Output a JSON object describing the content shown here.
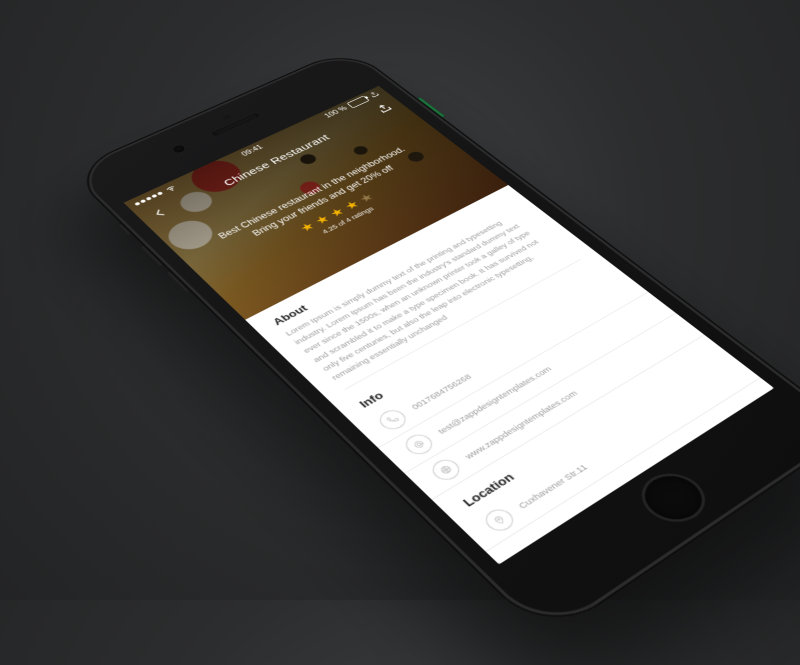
{
  "status_bar": {
    "time": "09:41",
    "carrier_signal_dots": 5,
    "wifi_icon": "wifi-icon",
    "battery_pct": "100 %"
  },
  "nav": {
    "back_icon": "chevron-left-icon",
    "title": "Chinese Restaurant",
    "share_icon": "share-icon"
  },
  "hero": {
    "line1": "Best Chinese restaurant in the neighborhood.",
    "line2": "Bring your friends and get 20% off",
    "stars_full": 4,
    "stars_total": 5,
    "ratings_text": "4.25 of 4 ratings"
  },
  "sections": {
    "about": {
      "title": "About",
      "body": "Lorem Ipsum is simply dummy text of the printing and typesetting industry. Lorem Ipsum has been the industry's standard dummy text ever since the 1500s, when an unknown printer took a galley of type and scrambled it to make a type specimen book. It has survived not only five centuries, but also the leap into electronic typesetting, remaining essentially unchanged"
    },
    "info": {
      "title": "Info",
      "rows": [
        {
          "icon": "phone-icon",
          "value": "0017684756268"
        },
        {
          "icon": "at-icon",
          "value": "test@zappdesigntemplates.com"
        },
        {
          "icon": "globe-icon",
          "value": "www.zappdesigntemplates.com"
        }
      ]
    },
    "location": {
      "title": "Location",
      "rows": [
        {
          "icon": "pin-icon",
          "value": "Cuxhavener Str.11"
        }
      ]
    }
  }
}
